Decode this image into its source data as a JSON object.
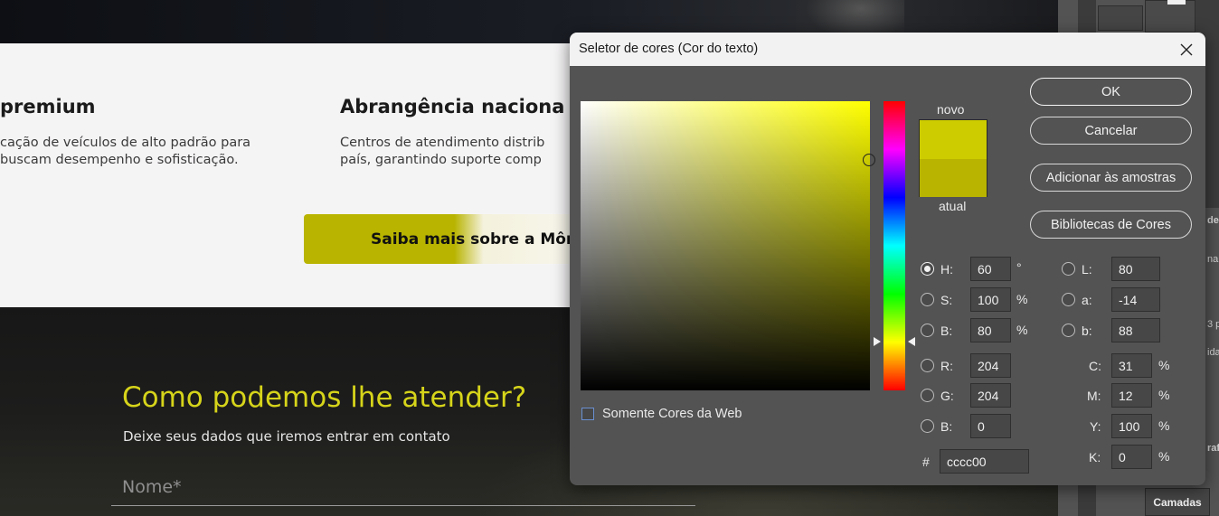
{
  "website": {
    "feature1": {
      "title": "premium",
      "line1": "cação de veículos de alto padrão  para",
      "line2": "buscam desempenho e sofisticação."
    },
    "feature2": {
      "title": "Abrangência naciona",
      "line1": "Centros de atendimento distrib",
      "line2": "país, garantindo suporte comp"
    },
    "cta_label": "Saiba mais sobre a Môn",
    "contact_title": "Como podemos lhe atender?",
    "contact_subtitle": "Deixe seus dados que iremos entrar em contato",
    "name_placeholder": "Nome*"
  },
  "photoshop_panel": {
    "side_texts": [
      "de",
      "na",
      "3 p",
      "ida",
      "rafi"
    ],
    "layers_tab": "Camadas"
  },
  "dialog": {
    "title": "Seletor de cores (Cor do texto)",
    "close_icon": "close-icon",
    "new_label": "novo",
    "current_label": "atual",
    "new_color": "#cccc00",
    "current_color": "#b8b400",
    "buttons": {
      "ok": "OK",
      "cancel": "Cancelar",
      "add_swatches": "Adicionar às amostras",
      "color_libraries": "Bibliotecas de Cores"
    },
    "web_colors_only": {
      "label": "Somente Cores da Web",
      "checked": false
    },
    "hsb": {
      "h": {
        "label": "H:",
        "value": "60",
        "unit": "°",
        "selected": true
      },
      "s": {
        "label": "S:",
        "value": "100",
        "unit": "%",
        "selected": false
      },
      "b": {
        "label": "B:",
        "value": "80",
        "unit": "%",
        "selected": false
      }
    },
    "rgb": {
      "r": {
        "label": "R:",
        "value": "204"
      },
      "g": {
        "label": "G:",
        "value": "204"
      },
      "b": {
        "label": "B:",
        "value": "0"
      }
    },
    "lab": {
      "l": {
        "label": "L:",
        "value": "80"
      },
      "a": {
        "label": "a:",
        "value": "-14"
      },
      "b": {
        "label": "b:",
        "value": "88"
      }
    },
    "cmyk": {
      "c": {
        "label": "C:",
        "value": "31",
        "unit": "%"
      },
      "m": {
        "label": "M:",
        "value": "12",
        "unit": "%"
      },
      "y": {
        "label": "Y:",
        "value": "100",
        "unit": "%"
      },
      "k": {
        "label": "K:",
        "value": "0",
        "unit": "%"
      }
    },
    "hex": {
      "label": "#",
      "value": "cccc00"
    },
    "hue_degrees": 60
  }
}
